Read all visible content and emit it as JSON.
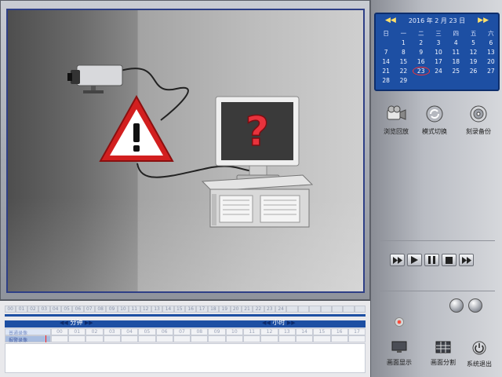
{
  "calendar": {
    "title": "2016 年 2 月 23 日",
    "prev_symbol": "◀◀",
    "next_symbol": "▶▶",
    "weekdays": [
      "日",
      "一",
      "二",
      "三",
      "四",
      "五",
      "六"
    ],
    "days": [
      "",
      "1",
      "2",
      "3",
      "4",
      "5",
      "6",
      "7",
      "8",
      "9",
      "10",
      "11",
      "12",
      "13",
      "14",
      "15",
      "16",
      "17",
      "18",
      "19",
      "20",
      "21",
      "22",
      "23",
      "24",
      "25",
      "26",
      "27",
      "28",
      "29",
      "",
      "",
      "",
      "",
      "",
      ""
    ],
    "selected_day": "23"
  },
  "toolbar": {
    "browse_label": "浏览回放",
    "mode_label": "模式切换",
    "burn_label": "刻录备份"
  },
  "playback": {
    "buttons": [
      "fast-forward",
      "play",
      "pause",
      "stop",
      "next"
    ]
  },
  "bottom_buttons": {
    "display_label": "画面显示",
    "split_label": "画面分割",
    "exit_label": "系统退出"
  },
  "timeline": {
    "minute_label": "分钟",
    "hour_label": "小时",
    "nav_prev": "◀◀",
    "nav_next": "▶▶",
    "hour_ticks": [
      "00",
      "01",
      "02",
      "03",
      "04",
      "05",
      "06",
      "07",
      "08",
      "09",
      "10",
      "11",
      "12",
      "13",
      "14",
      "15",
      "16",
      "17",
      "18",
      "19",
      "20",
      "21",
      "22",
      "23",
      "24",
      "",
      "",
      "",
      "",
      "",
      "",
      ""
    ],
    "row1_label": "普通录像",
    "row2_label": "报警录像",
    "row_ticks": [
      "00",
      "01",
      "02",
      "03",
      "04",
      "05",
      "06",
      "07",
      "08",
      "09",
      "10",
      "11",
      "12",
      "13",
      "14",
      "15",
      "16",
      "17"
    ]
  },
  "colors": {
    "accent_blue": "#1d4fa3",
    "selection_red": "#ff3030",
    "warning_red": "#d21f1f"
  }
}
